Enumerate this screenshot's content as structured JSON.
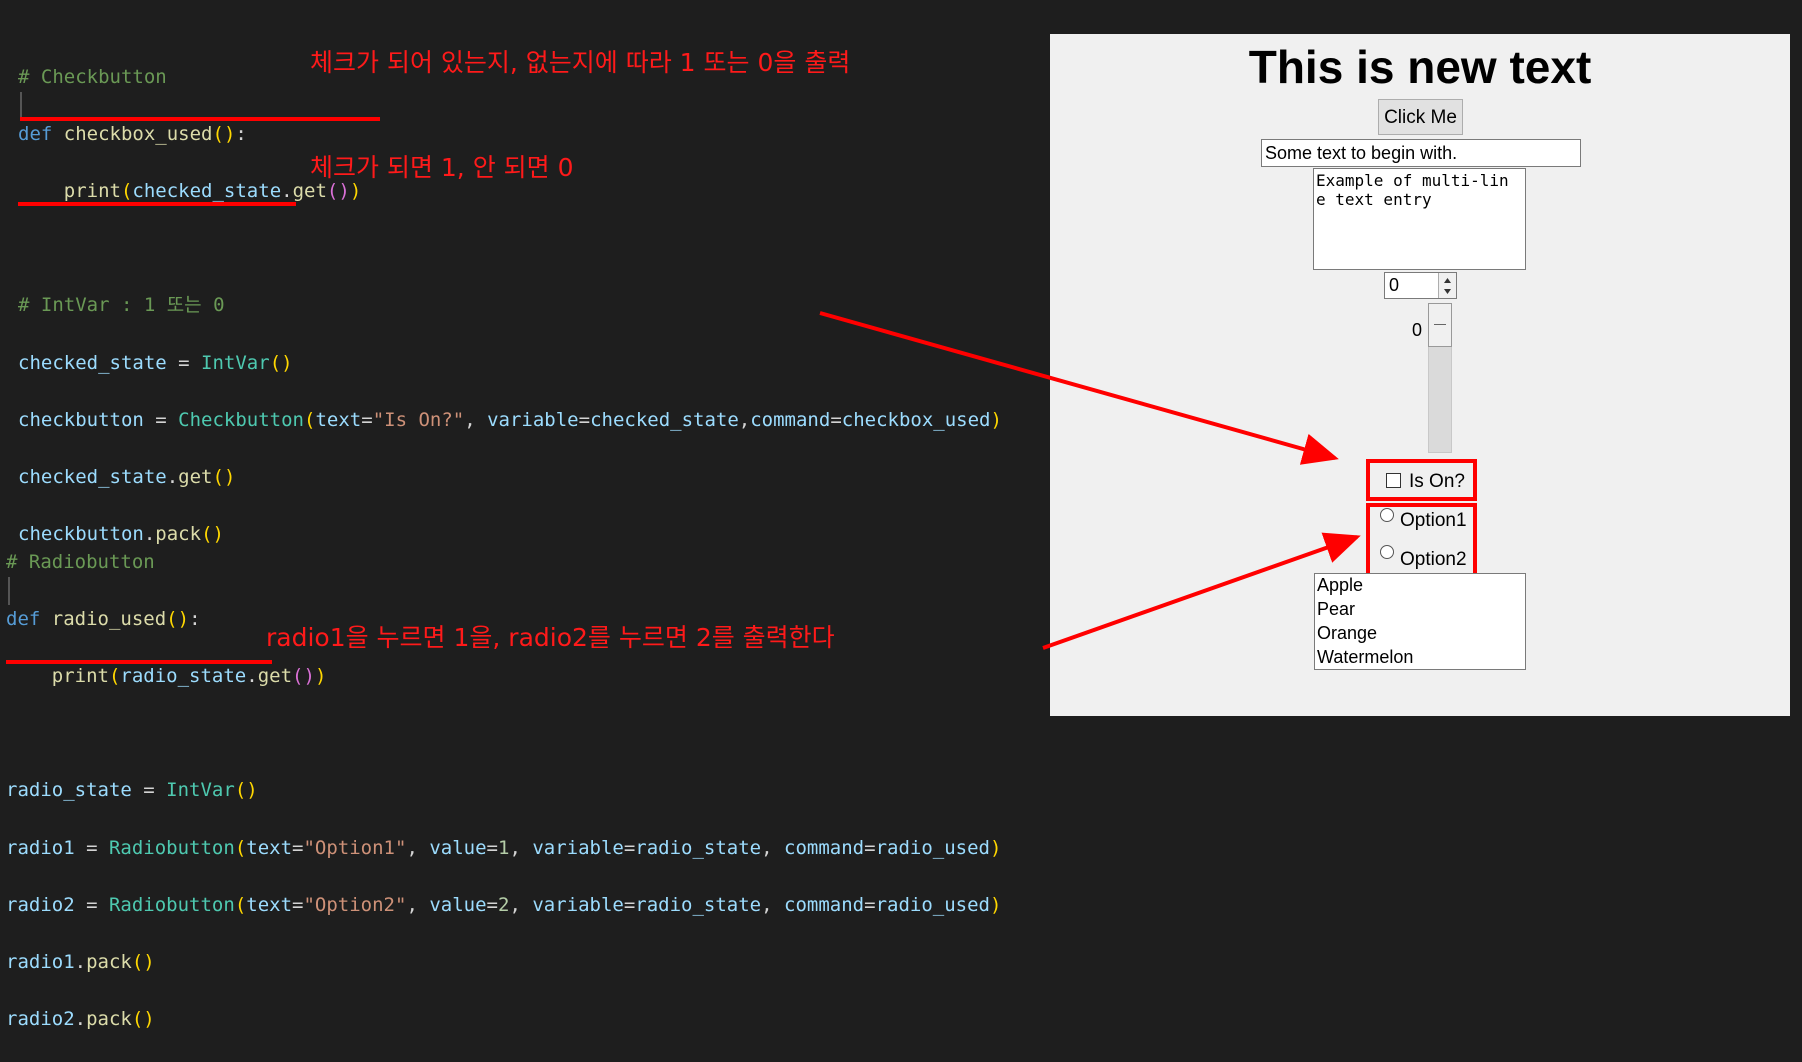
{
  "code_top": {
    "comment_checkbutton": "# Checkbutton",
    "def_kw": "def",
    "checkbox_fn": "checkbox_used",
    "print_fn": "print",
    "checked_state": "checked_state",
    "get_fn": "get",
    "comment_intvar": "# IntVar : 1 또는 0",
    "intvar_cls": "IntVar",
    "checkbutton_var": "checkbutton",
    "checkbutton_cls": "Checkbutton",
    "text_kw": "text",
    "is_on_str": "\"Is On?\"",
    "variable_kw": "variable",
    "command_kw": "command",
    "pack_fn": "pack"
  },
  "code_bottom": {
    "comment_radiobutton": "# Radiobutton",
    "def_kw": "def",
    "radio_fn": "radio_used",
    "print_fn": "print",
    "radio_state": "radio_state",
    "get_fn": "get",
    "intvar_cls": "IntVar",
    "radio1_var": "radio1",
    "radio2_var": "radio2",
    "radiobutton_cls": "Radiobutton",
    "text_kw": "text",
    "option1_str": "\"Option1\"",
    "option2_str": "\"Option2\"",
    "value_kw": "value",
    "value1": "1",
    "value2": "2",
    "variable_kw": "variable",
    "command_kw": "command",
    "pack_fn": "pack"
  },
  "annotations": {
    "checkbox_note": "체크가 되어 있는지, 없는지에 따라 1 또는 0을 출력",
    "intvar_note": "체크가 되면 1, 안 되면 0",
    "radio_note": "radio1을 누르면 1을, radio2를 누르면 2를 출력한다"
  },
  "tk_window": {
    "title_label": "This is new text",
    "button_label": "Click Me",
    "entry_value": "Some text to begin with.",
    "text_area_value": "Example of multi-lin\ne text entry",
    "spinbox_value": "0",
    "scale_value": "0",
    "checkbox_label": "Is On?",
    "radio1_label": "Option1",
    "radio2_label": "Option2",
    "listbox_items": [
      "Apple",
      "Pear",
      "Orange",
      "Watermelon"
    ]
  },
  "colors": {
    "editor_bg": "#1e1e1e",
    "annotation_red": "#ff0000",
    "tk_bg": "#f0f0f0"
  }
}
